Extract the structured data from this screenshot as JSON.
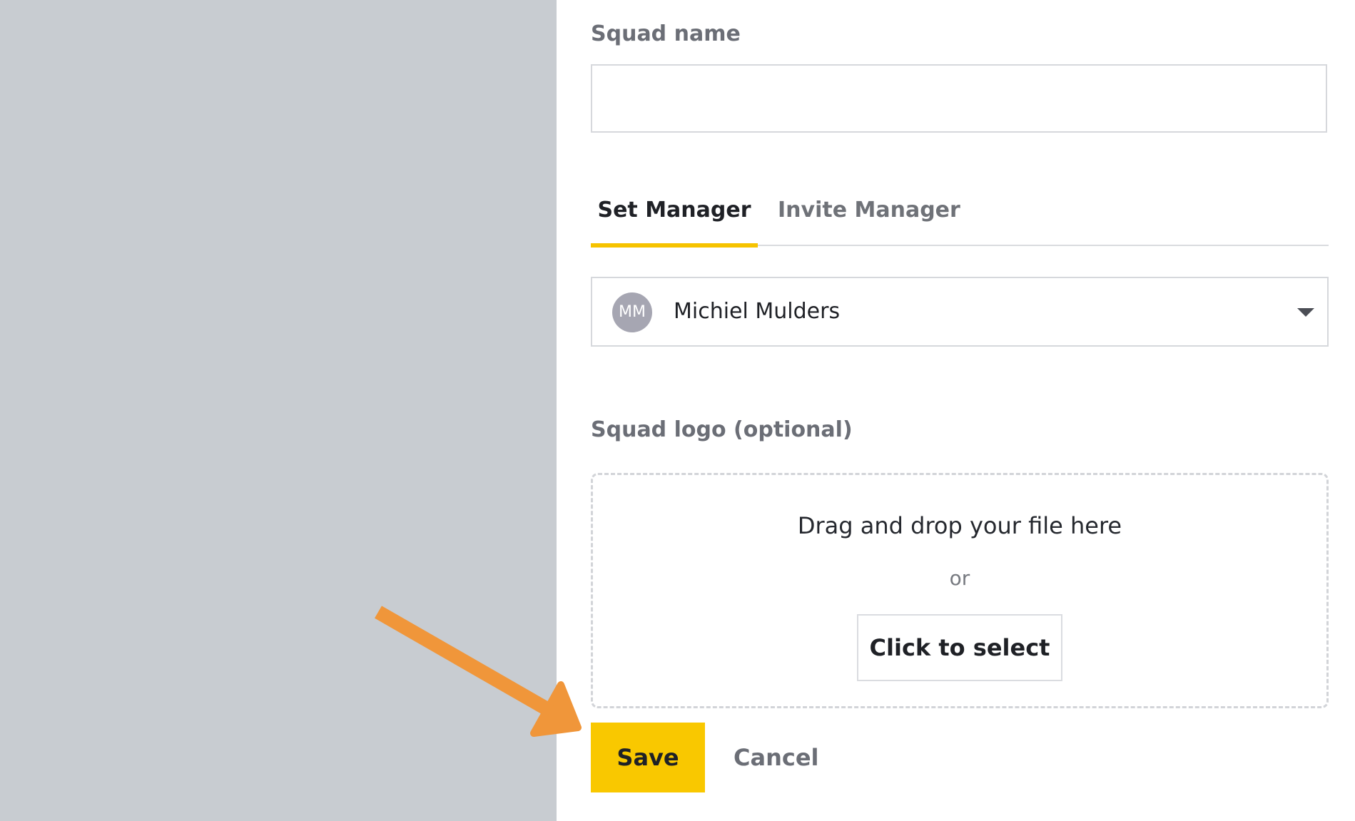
{
  "form": {
    "squad_name_label": "Squad name",
    "squad_name_value": "",
    "tabs": [
      {
        "label": "Set Manager",
        "active": true
      },
      {
        "label": "Invite Manager",
        "active": false
      }
    ],
    "manager_select": {
      "avatar_initials": "MM",
      "selected_value": "Michiel Mulders",
      "icon": "chevron-down-icon"
    },
    "logo_label": "Squad logo (optional)",
    "dropzone": {
      "main_text": "Drag and drop your file here",
      "or_text": "or",
      "select_button": "Click to select"
    },
    "save_label": "Save",
    "cancel_label": "Cancel"
  },
  "annotation": {
    "icon": "arrow-icon",
    "color": "#f0963a"
  },
  "colors": {
    "overlay": "#c8ccd1",
    "accent": "#f9c800",
    "tab_underline": "#f6c300"
  }
}
